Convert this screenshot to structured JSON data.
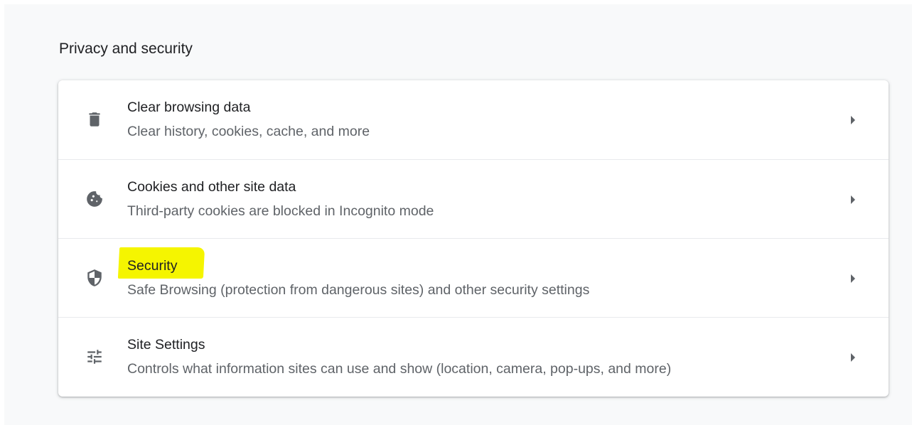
{
  "section": {
    "title": "Privacy and security"
  },
  "rows": [
    {
      "title": "Clear browsing data",
      "subtitle": "Clear history, cookies, cache, and more",
      "icon": "trash-icon"
    },
    {
      "title": "Cookies and other site data",
      "subtitle": "Third-party cookies are blocked in Incognito mode",
      "icon": "cookie-icon"
    },
    {
      "title": "Security",
      "subtitle": "Safe Browsing (protection from dangerous sites) and other security settings",
      "icon": "shield-icon",
      "highlight_color": "#f5f500"
    },
    {
      "title": "Site Settings",
      "subtitle": "Controls what information sites can use and show (location, camera, pop-ups, and more)",
      "icon": "sliders-icon"
    }
  ],
  "colors": {
    "page_background": "#f8f9fa",
    "card_background": "#ffffff",
    "title_text": "#202124",
    "secondary_text": "#5f6368",
    "divider": "#e8eaed"
  }
}
